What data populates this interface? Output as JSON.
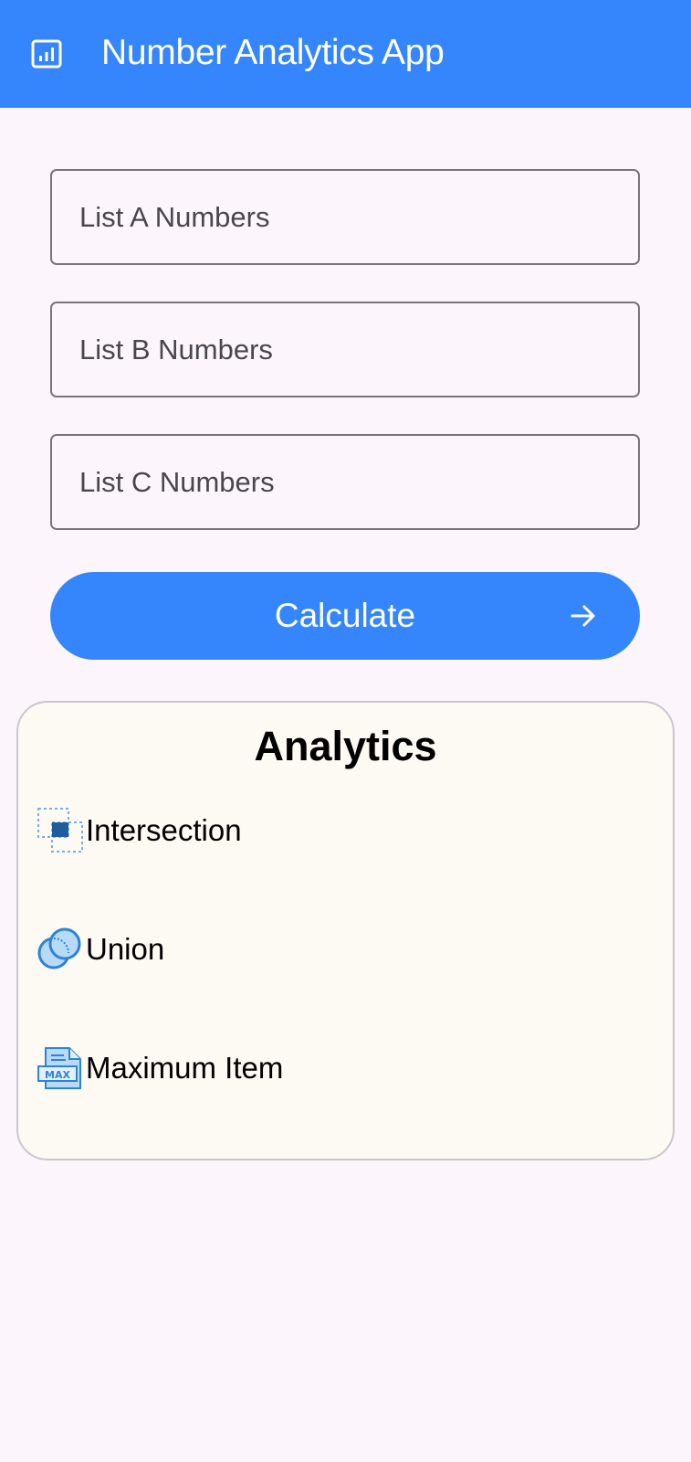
{
  "appbar": {
    "title": "Number Analytics App",
    "icon": "analytics-chart-icon",
    "color": "#3586fc"
  },
  "form": {
    "list_a_placeholder": "List A Numbers",
    "list_b_placeholder": "List B Numbers",
    "list_c_placeholder": "List C Numbers",
    "calculate_label": "Calculate",
    "calculate_icon": "arrow-right-icon"
  },
  "analytics": {
    "title": "Analytics",
    "items": [
      {
        "label": "Intersection",
        "icon": "intersection-icon"
      },
      {
        "label": "Union",
        "icon": "union-icon"
      },
      {
        "label": "Maximum Item",
        "icon": "max-document-icon"
      }
    ]
  }
}
